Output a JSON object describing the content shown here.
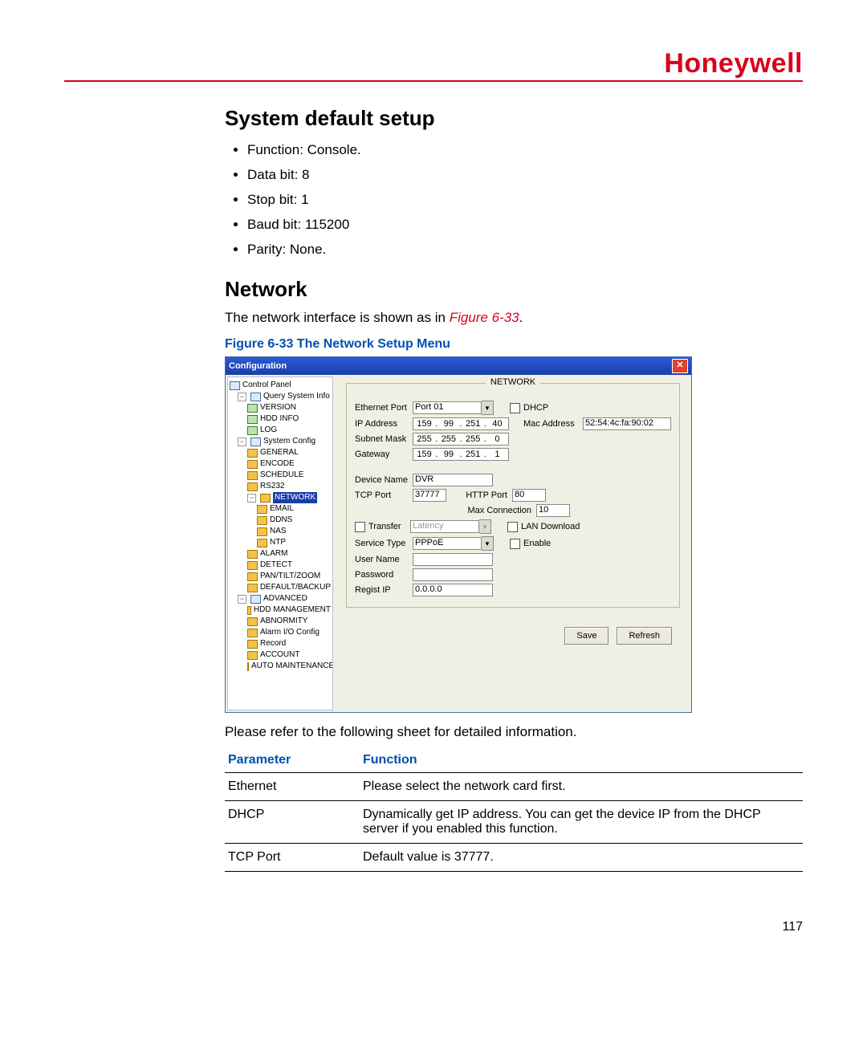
{
  "brand": "Honeywell",
  "section1_title": "System default setup",
  "bullets": [
    "Function: Console.",
    "Data bit: 8",
    "Stop bit: 1",
    "Baud bit: 115200",
    "Parity: None."
  ],
  "section2_title": "Network",
  "network_intro_pre": "The network interface is shown as in ",
  "network_intro_ref": "Figure 6-33",
  "network_intro_post": ".",
  "figure_caption": "Figure 6-33 The Network Setup Menu",
  "window": {
    "title": "Configuration",
    "close": "✕",
    "group_legend": "NETWORK",
    "tree": {
      "root": "Control Panel",
      "qsi": "Query System Info",
      "version": "VERSION",
      "hddinfo": "HDD INFO",
      "log": "LOG",
      "sysconf": "System Config",
      "general": "GENERAL",
      "encode": "ENCODE",
      "schedule": "SCHEDULE",
      "rs232": "RS232",
      "network": "NETWORK",
      "email": "EMAIL",
      "ddns": "DDNS",
      "nas": "NAS",
      "ntp": "NTP",
      "alarm": "ALARM",
      "detect": "DETECT",
      "ptz": "PAN/TILT/ZOOM",
      "default": "DEFAULT/BACKUP",
      "advanced": "ADVANCED",
      "hddm": "HDD MANAGEMENT",
      "abn": "ABNORMITY",
      "aio": "Alarm I/O Config",
      "record": "Record",
      "account": "ACCOUNT",
      "auto": "AUTO MAINTENANCE"
    },
    "labels": {
      "eth": "Ethernet Port",
      "dhcp": "DHCP",
      "ip": "IP Address",
      "mac": "Mac Address",
      "subnet": "Subnet Mask",
      "gateway": "Gateway",
      "devname": "Device Name",
      "tcpport": "TCP Port",
      "httpport": "HTTP Port",
      "maxconn": "Max Connection",
      "transfer": "Transfer",
      "latency": "Latency",
      "landl": "LAN Download",
      "svctype": "Service Type",
      "enable": "Enable",
      "uname": "User Name",
      "pwd": "Password",
      "regip": "Regist IP"
    },
    "values": {
      "eth": "Port 01",
      "ip": [
        "159",
        "99",
        "251",
        "40"
      ],
      "mac": "52:54:4c:fa:90:02",
      "subnet": [
        "255",
        "255",
        "255",
        "0"
      ],
      "gateway": [
        "159",
        "99",
        "251",
        "1"
      ],
      "devname": "DVR",
      "tcpport": "37777",
      "httpport": "80",
      "maxconn": "10",
      "svctype": "PPPoE",
      "regip": "0.0.0.0"
    },
    "buttons": {
      "save": "Save",
      "refresh": "Refresh"
    }
  },
  "after_fig": "Please refer to the following sheet for detailed information.",
  "table": {
    "h1": "Parameter",
    "h2": "Function",
    "rows": [
      {
        "p": "Ethernet",
        "f": "Please select the network card first."
      },
      {
        "p": "DHCP",
        "f": "Dynamically get IP address. You can get the device IP from the DHCP server if you enabled this function."
      },
      {
        "p": "TCP Port",
        "f": "Default value is 37777."
      }
    ]
  },
  "page_number": "117"
}
